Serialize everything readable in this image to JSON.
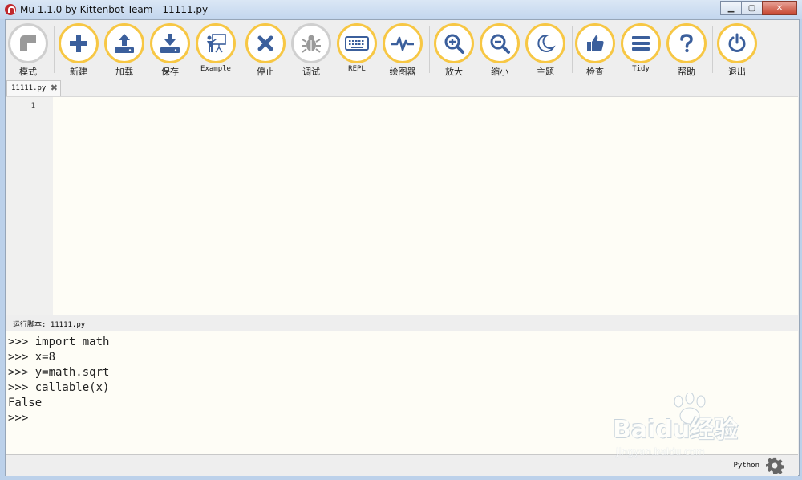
{
  "window": {
    "title": "Mu 1.1.0 by Kittenbot Team - 11111.py"
  },
  "toolbar": {
    "buttons": [
      {
        "label": "模式",
        "icon": "mode-icon"
      },
      {
        "label": "新建",
        "icon": "plus-icon"
      },
      {
        "label": "加载",
        "icon": "upload-icon"
      },
      {
        "label": "保存",
        "icon": "download-icon"
      },
      {
        "label": "Example",
        "icon": "presenter-icon"
      },
      {
        "label": "停止",
        "icon": "stop-x-icon"
      },
      {
        "label": "调试",
        "icon": "bug-icon"
      },
      {
        "label": "REPL",
        "icon": "keyboard-icon"
      },
      {
        "label": "绘图器",
        "icon": "pulse-icon"
      },
      {
        "label": "放大",
        "icon": "zoom-in-icon"
      },
      {
        "label": "缩小",
        "icon": "zoom-out-icon"
      },
      {
        "label": "主题",
        "icon": "moon-icon"
      },
      {
        "label": "检查",
        "icon": "thumbs-up-icon"
      },
      {
        "label": "Tidy",
        "icon": "lines-icon"
      },
      {
        "label": "帮助",
        "icon": "question-icon"
      },
      {
        "label": "退出",
        "icon": "power-icon"
      }
    ]
  },
  "tab": {
    "label": "11111.py",
    "close": "✖"
  },
  "editor": {
    "line_number": "1"
  },
  "pane": {
    "label": "运行脚本: 11111.py"
  },
  "repl": {
    "lines": [
      ">>> import math",
      ">>> x=8",
      ">>> y=math.sqrt",
      ">>> callable(x)",
      "False",
      ">>> "
    ]
  },
  "status": {
    "mode": "Python"
  },
  "watermark": {
    "logo": "Baidu经验",
    "url": "jingyan.baidu.com"
  },
  "colors": {
    "accent": "#f7c744",
    "icon": "#3b5f9c",
    "editor_bg": "#fefdf6"
  }
}
